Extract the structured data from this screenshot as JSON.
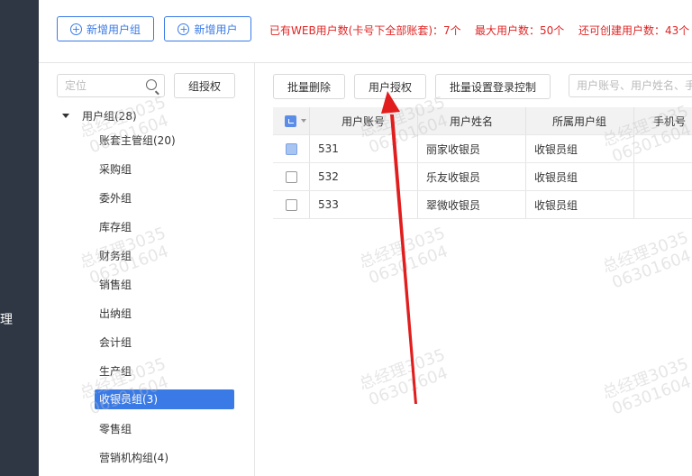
{
  "nav": {
    "fragment_text": "理"
  },
  "top": {
    "add_group_label": "新增用户组",
    "add_user_label": "新增用户",
    "stat_existing": "已有WEB用户数(卡号下全部账套)：7个",
    "stat_max": "最大用户数：50个",
    "stat_remaining": "还可创建用户数：43个"
  },
  "sidebar": {
    "search_placeholder": "定位",
    "group_auth_label": "组授权",
    "root_label": "用户组(28)",
    "items": [
      "账套主管组(20)",
      "采购组",
      "委外组",
      "库存组",
      "财务组",
      "销售组",
      "出纳组",
      "会计组",
      "生产组",
      "收银员组(3)",
      "零售组",
      "营销机构组(4)"
    ]
  },
  "toolbar": {
    "batch_delete_label": "批量删除",
    "user_auth_label": "用户授权",
    "batch_login_label": "批量设置登录控制",
    "search_placeholder": "用户账号、用户姓名、手"
  },
  "table": {
    "columns": [
      "用户账号",
      "用户姓名",
      "所属用户组",
      "手机号"
    ],
    "rows": [
      {
        "account": "531",
        "name": "丽家收银员",
        "group": "收银员组",
        "phone": ""
      },
      {
        "account": "532",
        "name": "乐友收银员",
        "group": "收银员组",
        "phone": ""
      },
      {
        "account": "533",
        "name": "翠微收银员",
        "group": "收银员组",
        "phone": ""
      }
    ]
  },
  "watermark": {
    "line1": "总经理3035",
    "line2": "06301604"
  },
  "colors": {
    "accent": "#3a7ae6",
    "nav": "#2f3744",
    "alert": "#e02424",
    "arrow": "#e11d1d"
  }
}
